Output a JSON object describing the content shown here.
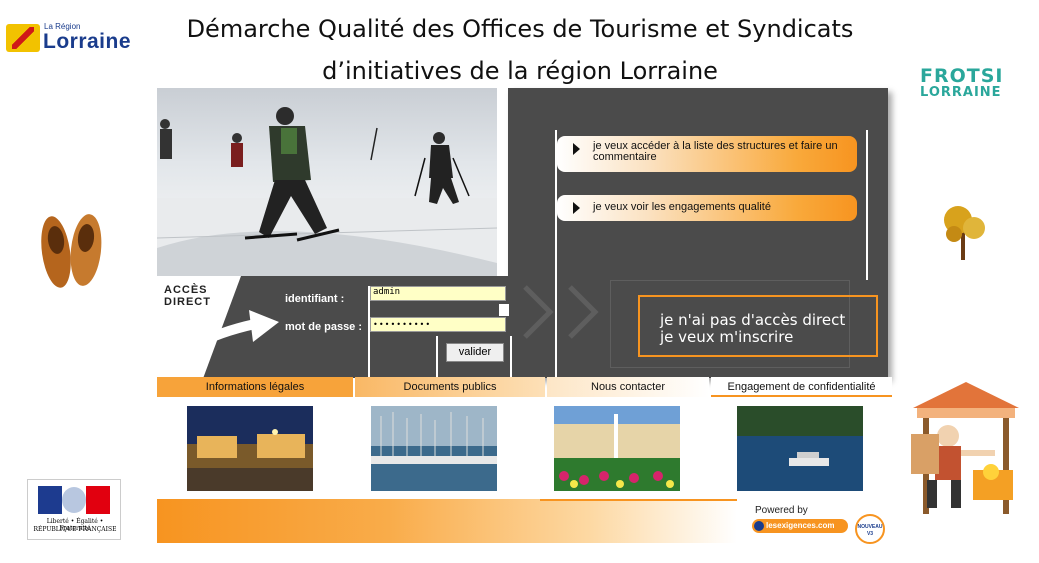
{
  "header": {
    "title_line1": "Démarche Qualité des Offices de Tourisme et Syndicats",
    "title_line2": "d’initiatives de la région Lorraine"
  },
  "logos": {
    "region_small": "La Région",
    "region_big": "Lorraine",
    "frotsi_line1": "FROTSI",
    "frotsi_line2": "LORRAINE",
    "rf_line1": "Liberté • Égalité • Fraternité",
    "rf_line2": "RÉPUBLIQUE FRANÇAISE"
  },
  "actions": {
    "structures_label": "je veux accéder à la liste des structures et faire un commentaire",
    "engagements_label": "je veux voir les engagements qualité",
    "signup_line1": "je n'ai pas d'accès direct",
    "signup_line2": "je veux m'inscrire"
  },
  "login": {
    "title_line1": "ACCÈS",
    "title_line2": "DIRECT",
    "identifiant_label": "identifiant :",
    "identifiant_value": "admin",
    "password_label": "mot de passe :",
    "password_value": "••••••••••",
    "submit_label": "valider"
  },
  "nav": {
    "items": [
      {
        "label": "Informations légales"
      },
      {
        "label": "Documents publics"
      },
      {
        "label": "Nous contacter"
      },
      {
        "label": "Engagement de confidentialité"
      }
    ]
  },
  "footer": {
    "powered_by": "Powered by",
    "brand": "lesexigences.com",
    "badge_line1": "NOUVEAU",
    "badge_line2": "V3"
  },
  "colors": {
    "accent": "#f79420",
    "panel": "#4b4b4b",
    "input_bg": "#ffffc6"
  }
}
